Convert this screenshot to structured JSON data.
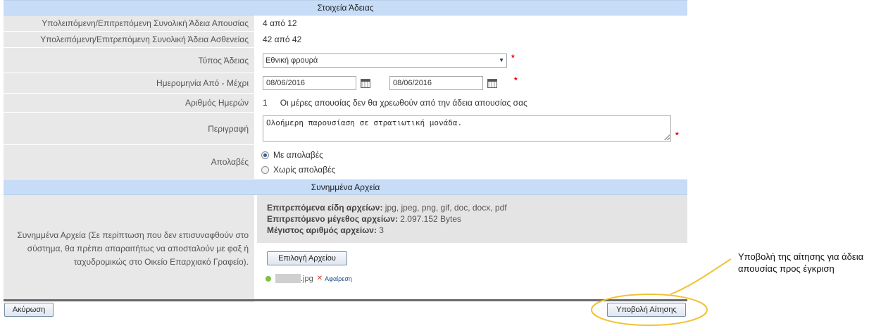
{
  "sections": {
    "leave_details": "Στοιχεία Άδειας",
    "attachments": "Συνημμένα Αρχεία"
  },
  "balance": {
    "absence_label": "Υπολειπόμενη/Επιτρεπόμενη Συνολική Άδεια Απουσίας",
    "absence_value": "4 από 12",
    "sick_label": "Υπολειπόμενη/Επιτρεπόμενη Συνολική Άδεια Ασθενείας",
    "sick_value": "42 από 42"
  },
  "leave_type": {
    "label": "Τύπος Άδειας",
    "selected": "Εθνική φρουρά"
  },
  "dates": {
    "label": "Ημερομηνία Από - Μέχρι",
    "from": "08/06/2016",
    "to": "08/06/2016"
  },
  "days": {
    "label": "Αριθμός Ημερών",
    "count": "1",
    "note": "Οι μέρες απουσίας δεν θα χρεωθούν από την άδεια απουσίας σας"
  },
  "description": {
    "label": "Περιγραφή",
    "value": "Ολοήμερη παρουσίαση σε στρατιωτική μονάδα."
  },
  "pay": {
    "label": "Απολαβές",
    "option_with": "Με απολαβές",
    "option_without": "Χωρίς απολαβές"
  },
  "required_mark": "*",
  "attachments": {
    "label": "Συνημμένα Αρχεία (Σε περίπτωση που δεν επισυναφθούν στο σύστημα, θα πρέπει απαραιτήτως να αποσταλούν με φαξ ή ταχυδρομικώς στο Οικείο Επαρχιακό Γραφείο).",
    "types_label": "Επιτρεπόμενα είδη αρχείων:",
    "types_value": " jpg, jpeg, png, gif, doc, docx, pdf",
    "size_label": "Επιτρεπόμενο μέγεθος αρχείων:",
    "size_value": " 2.097.152 Bytes",
    "max_label": "Μέγιστος αριθμός αρχείων:",
    "max_value": " 3",
    "choose_button": "Επιλογή Αρχείου",
    "file_ext": ".jpg",
    "remove_label": "Αφαίρεση"
  },
  "footer": {
    "cancel": "Ακύρωση",
    "submit": "Υποβολή Αίτησης"
  },
  "callout": "Υποβολή της αίτησης για άδεια απουσίας προς έγκριση",
  "colors": {
    "header_bg": "#c6dcf7",
    "label_bg": "#e8e8e8",
    "required": "#ee0000",
    "annotation": "#f1c232"
  }
}
